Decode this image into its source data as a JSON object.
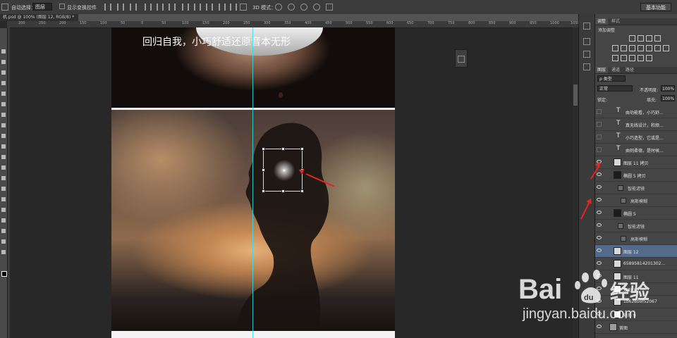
{
  "options_bar": {
    "auto_select_label": "自动选择：",
    "auto_select_value": "图层",
    "show_transform_label": "显示变换控件",
    "mode_3d_label": "3D 模式：",
    "workspace": "基本功能"
  },
  "document_tab": "机.psd @ 100% (图层 12, RGB/8) *",
  "ruler_ticks": [
    "200",
    "250",
    "200",
    "150",
    "100",
    "50",
    "0",
    "50",
    "100",
    "150",
    "200",
    "250",
    "300",
    "350",
    "400",
    "450",
    "500",
    "550",
    "600",
    "650",
    "700",
    "750",
    "800",
    "850",
    "900",
    "950",
    "1000",
    "1050"
  ],
  "canvas": {
    "caption": "回归自我，小巧舒适还原音本无形"
  },
  "panels": {
    "adjust_tabs": [
      "调整",
      "样式"
    ],
    "adjust_title": "添加调整",
    "layers_tabs": [
      "图层",
      "通道",
      "路径"
    ],
    "filter_kind": "ρ 类型",
    "blend_mode": "正常",
    "opacity_label": "不透明度:",
    "opacity_value": "100%",
    "lock_label": "锁定:",
    "fill_label": "填充:",
    "fill_value": "100%"
  },
  "layers": [
    {
      "name": "由功能看，小巧舒...",
      "kind": "text",
      "visible": false
    },
    {
      "name": "真无线设计，和烦...",
      "kind": "text",
      "visible": false
    },
    {
      "name": "小巧造型，它或是...",
      "kind": "text",
      "visible": false
    },
    {
      "name": "由则柔德，是时候...",
      "kind": "text",
      "visible": false
    },
    {
      "name": "图层 11 拷贝",
      "kind": "image",
      "visible": true
    },
    {
      "name": "椭圆 5 拷贝",
      "kind": "smart",
      "visible": true
    },
    {
      "name": "智能滤镜",
      "kind": "filter",
      "visible": true
    },
    {
      "name": "高斯模糊",
      "kind": "filter-item",
      "visible": true
    },
    {
      "name": "椭圆 5",
      "kind": "smart",
      "visible": true
    },
    {
      "name": "智能滤镜",
      "kind": "filter",
      "visible": true
    },
    {
      "name": "高斯模糊",
      "kind": "filter-item",
      "visible": true
    },
    {
      "name": "图层 12",
      "kind": "image",
      "visible": true,
      "selected": true
    },
    {
      "name": "65895814201302...",
      "kind": "image",
      "visible": true
    },
    {
      "name": "图层 11",
      "kind": "image",
      "visible": true
    },
    {
      "name": "矩形 10",
      "kind": "shape",
      "visible": true
    },
    {
      "name": "1b62eb9f52067",
      "kind": "image",
      "visible": true
    },
    {
      "name": "矩形 9",
      "kind": "shape",
      "visible": true
    },
    {
      "name": "首图",
      "kind": "group",
      "visible": true
    }
  ],
  "watermark": {
    "brand": "Bai",
    "paw": "du",
    "cn": "经验",
    "url": "jingyan.baidu.com"
  },
  "colors": {
    "selection": "#546a8a",
    "guide": "#33e0e6",
    "annotation_arrow": "#e3271f"
  }
}
